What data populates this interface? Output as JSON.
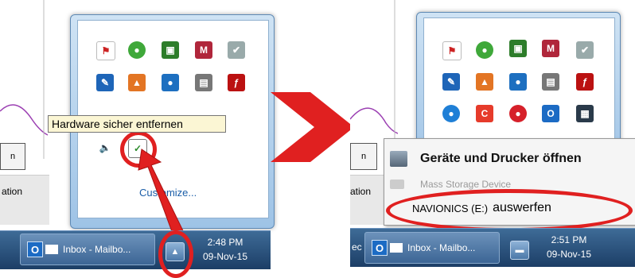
{
  "tooltip": {
    "text": "Hardware sicher entfernen"
  },
  "left": {
    "customize_label": "Customize...",
    "side_button_label": "n",
    "side_text": "ation",
    "taskbar": {
      "app_label": "Inbox - Mailbo...",
      "time": "2:48 PM",
      "date": "09-Nov-15"
    }
  },
  "right": {
    "side_button_label": "n",
    "side_text": "ation",
    "menu": {
      "devices_label": "Geräte und Drucker öffnen",
      "mass_storage_label": "Mass Storage Device",
      "eject_drive": "NAVIONICS (E:)",
      "eject_label": "auswerfen"
    },
    "taskbar": {
      "left_fragment": "ec",
      "app_label": "Inbox - Mailbo...",
      "time": "2:51 PM",
      "date": "09-Nov-15"
    }
  },
  "colors": {
    "annotation_red": "#e02020",
    "taskbar": "#2b5381",
    "tooltip_bg": "#fbf6d4"
  },
  "icons": {
    "left_row1": [
      "flag-error-icon",
      "green-circle-icon",
      "green-monitor-icon",
      "shield-icon",
      "network-check-icon"
    ],
    "left_row2": [
      "wrench-icon",
      "orange-app-icon",
      "fox-icon",
      "server-icon",
      "flash-icon"
    ],
    "right_row1": [
      "flag-error-icon",
      "green-circle-icon",
      "green-monitor-icon",
      "shield-icon",
      "network-check-icon"
    ],
    "right_row2": [
      "wrench-icon",
      "orange-app-icon",
      "fox-icon",
      "server-icon",
      "flash-icon"
    ],
    "right_row3": [
      "globe-icon",
      "c-app-icon",
      "red-o-icon",
      "outlook-icon",
      "grid-icon"
    ]
  }
}
